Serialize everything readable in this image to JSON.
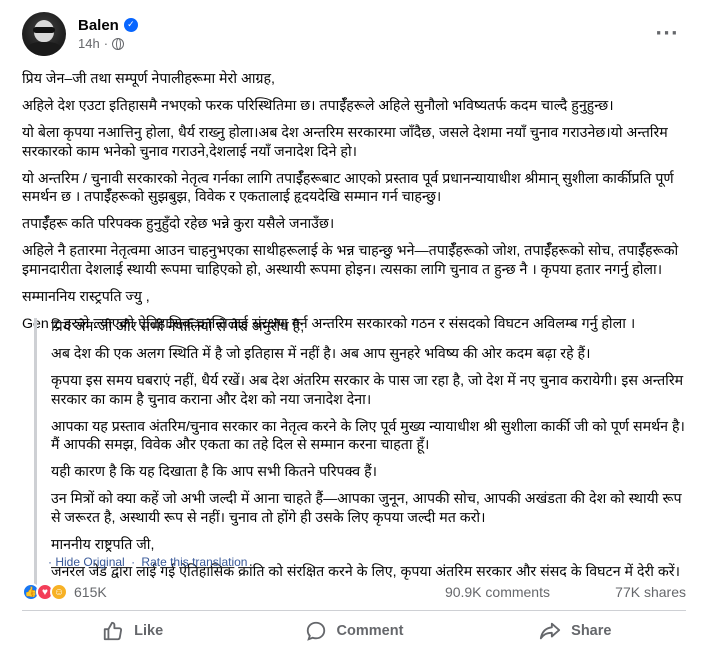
{
  "author": {
    "name": "Balen",
    "time": "14h"
  },
  "post": {
    "paragraphs": [
      "प्रिय जेन–जी तथा सम्पूर्ण नेपालीहरूमा मेरो आग्रह,",
      "अहिले देश एउटा इतिहासमै नभएको फरक परिस्थितिमा छ। तपाईँहरूले अहिले सुनौलो भविष्यतर्फ कदम चाल्दै हुनुहुन्छ।",
      "यो बेला कृपया नआत्तिनु होला, धैर्य राख्नु होला।अब देश अन्तरिम सरकारमा जाँदैछ, जसले देशमा नयाँ चुनाव गराउनेछ।यो अन्तरिम सरकारको काम भनेको चुनाव गराउने,देशलाई नयाँ जनादेश दिने हो।",
      "यो अन्तरिम / चुनावी सरकारको नेतृत्व गर्नका लागि तपाईँहरूबाट आएको प्रस्ताव पूर्व प्रधानन्यायाधीश श्रीमान् सुशीला कार्कीप्रति पूर्ण समर्थन छ । तपाईँहरूको सुझबुझ, विवेक र एकतालाई हृदयदेखि सम्मान गर्न चाहन्छु।",
      "तपाईँहरू कति परिपक्क हुनुहुँदो रहेछ भन्ने कुरा यसैले जनाउँछ।",
      "अहिले नै हतारमा नेतृत्वमा आउन चाहनुभएका साथीहरूलाई के भन्न चाहन्छु भने—तपाईँहरूको जोश, तपाईँहरूको सोच, तपाईँहरूको इमानदारीता  देशलाई स्थायी रूपमा चाहिएको हो, अस्थायी रूपमा होइन। त्यसका लागि चुनाव त हुन्छ नै । कृपया हतार नगर्नु होला।",
      "सम्माननिय रास्ट्रपति ज्यु ,",
      "Gen z हरुले ल्याएको ऐतिहासिक क्रान्तिलाई संरक्षण गर्न अन्तरिम सरकारको गठन र  संसदको विघटन अविलम्ब गर्नु होला ।"
    ]
  },
  "translation": {
    "paragraphs": [
      "प्रिय जेन-जी और सभी नेपालियों से मेरा अनुरोध है,",
      "अब देश की एक अलग स्थिति में है जो इतिहास में नहीं है। अब आप सुनहरे भविष्य की ओर कदम बढ़ा रहे हैं।",
      "कृपया इस समय घबराएं नहीं, धैर्य रखें। अब देश अंतरिम सरकार के पास जा रहा है, जो देश में नए चुनाव करायेगी। इस अन्तरिम सरकार का काम है चुनाव कराना और देश को नया जनादेश देना।",
      "आपका यह प्रस्ताव अंतरिम/चुनाव सरकार का नेतृत्व करने के लिए पूर्व मुख्य न्यायाधीश श्री सुशीला कार्की जी को पूर्ण समर्थन है। मैं आपकी समझ, विवेक और एकता का तहे दिल से सम्मान करना चाहता हूँ।",
      "यही कारण है कि यह दिखाता है कि आप सभी कितने परिपक्व हैं।",
      "उन मित्रों को क्या कहें जो अभी जल्दी में आना चाहते हैं—आपका जुनून, आपकी सोच, आपकी अखंडता की देश को स्थायी रूप से जरूरत है, अस्थायी रूप से नहीं। चुनाव तो होंगे ही उसके लिए कृपया जल्दी मत करो।",
      "माननीय राष्ट्रपति जी,",
      "जनरल जेड द्वारा लाई गई ऐतिहासिक क्रांति को संरक्षित करने के लिए, कृपया अंतरिम सरकार और संसद के विघटन में देरी करें।"
    ],
    "hide_original": "Hide Original",
    "rate_translation": "Rate this translation",
    "separator": "·"
  },
  "stats": {
    "reactions_count": "615K",
    "comments": "90.9K comments",
    "shares": "77K shares"
  },
  "actions": {
    "like": "Like",
    "comment": "Comment",
    "share": "Share"
  },
  "icons": {
    "more": "more-options-icon",
    "privacy": "globe-icon",
    "verified": "verified-badge-icon",
    "reactions": [
      "like-reaction-icon",
      "love-reaction-icon",
      "care-reaction-icon"
    ]
  },
  "colors": {
    "link": "#385898",
    "secondary_text": "#65676b",
    "verified": "#0866ff",
    "like_blue": "#1877f2",
    "love_red": "#f33e58",
    "care_yellow": "#f7b125"
  }
}
